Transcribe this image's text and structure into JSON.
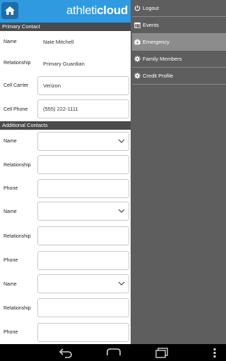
{
  "app": {
    "brand_light": "athleti",
    "brand_bold": "cloud"
  },
  "primary_contact": {
    "header": "Primary Contact",
    "fields": [
      {
        "label": "Name",
        "value": "Nate Mitchell"
      },
      {
        "label": "Relationship",
        "value": "Primary Guardian"
      },
      {
        "label": "Cell Carrier",
        "value": "Verizon"
      },
      {
        "label": "Cell Phone",
        "value": "(555) 222-1111"
      }
    ]
  },
  "additional_contacts": {
    "header": "Additional Contacts",
    "fields": [
      {
        "label": "Name",
        "value": ""
      },
      {
        "label": "Relationship",
        "value": ""
      },
      {
        "label": "Phone",
        "value": ""
      },
      {
        "label": "Name",
        "value": ""
      },
      {
        "label": "Relationship",
        "value": ""
      },
      {
        "label": "Phone",
        "value": ""
      },
      {
        "label": "Name",
        "value": ""
      },
      {
        "label": "Relationship",
        "value": ""
      },
      {
        "label": "Phone",
        "value": ""
      }
    ]
  },
  "menu": {
    "items": [
      {
        "label": "Logout",
        "icon": "power-icon"
      },
      {
        "label": "Events",
        "icon": "calendar-icon"
      },
      {
        "label": "Emergency",
        "icon": "medkit-icon",
        "active": true
      },
      {
        "label": "Family Members",
        "icon": "gear-icon"
      },
      {
        "label": "Credit Profile",
        "icon": "gear-icon"
      }
    ]
  },
  "colors": {
    "header_blue": "#2f9ae0",
    "section_dark": "#4a4a4a",
    "drawer_gray": "#5e5e5e",
    "active_gray": "#8c8c8c"
  },
  "navbar": {
    "buttons": [
      "back-icon",
      "home-icon",
      "recent-apps-icon",
      "menu-icon"
    ]
  }
}
